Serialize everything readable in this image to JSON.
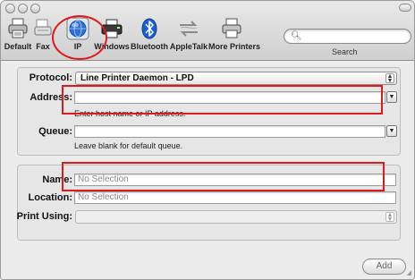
{
  "toolbar": {
    "items": [
      {
        "label": "Default",
        "icon": "printer-icon"
      },
      {
        "label": "Fax",
        "icon": "fax-icon"
      },
      {
        "label": "IP",
        "icon": "globe-icon"
      },
      {
        "label": "Windows",
        "icon": "windows-printer-icon"
      },
      {
        "label": "Bluetooth",
        "icon": "bluetooth-icon"
      },
      {
        "label": "AppleTalk",
        "icon": "appletalk-icon"
      },
      {
        "label": "More Printers",
        "icon": "printer-icon"
      }
    ],
    "search": {
      "label": "Search",
      "value": ""
    }
  },
  "form": {
    "protocol_label": "Protocol:",
    "protocol_value": "Line Printer Daemon - LPD",
    "address_label": "Address:",
    "address_value": "",
    "address_hint": "Enter host name or IP address.",
    "queue_label": "Queue:",
    "queue_value": "",
    "queue_hint": "Leave blank for default queue.",
    "name_label": "Name:",
    "name_value": "No Selection",
    "location_label": "Location:",
    "location_value": "No Selection",
    "print_using_label": "Print Using:",
    "print_using_value": ""
  },
  "actions": {
    "add_label": "Add"
  },
  "colors": {
    "annotation": "#e0191c",
    "bluetooth": "#1a5fd0",
    "globe": "#2b6fd8"
  }
}
